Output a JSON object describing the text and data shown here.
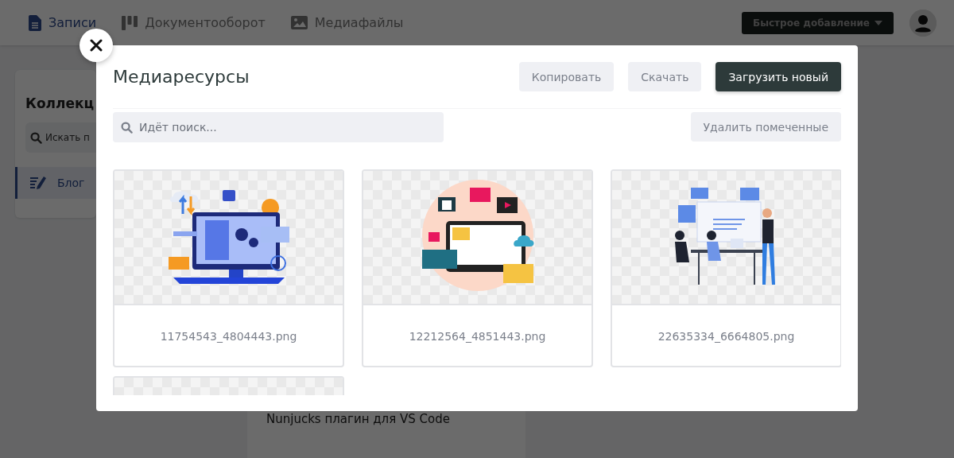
{
  "nav": {
    "items": [
      {
        "label": "Записи",
        "selected": true
      },
      {
        "label": "Документооборот",
        "selected": false
      },
      {
        "label": "Медиафайлы",
        "selected": false
      }
    ],
    "quick_add": "Быстрое добавление"
  },
  "sidebar": {
    "title": "Коллекц",
    "search": {
      "placeholder": "Искать п"
    },
    "items": [
      {
        "label": "Блог",
        "selected": true
      }
    ]
  },
  "content": {
    "entries": [
      "Nunjucks плагин для VS Code"
    ]
  },
  "modal": {
    "title": "Медиаресурсы",
    "actions": [
      {
        "label": "Копировать",
        "kind": "secondary"
      },
      {
        "label": "Скачать",
        "kind": "secondary"
      },
      {
        "label": "Загрузить новый",
        "kind": "primary"
      }
    ],
    "search": {
      "placeholder": "Идёт поиск..."
    },
    "delete_button": "Удалить помеченные",
    "files": [
      {
        "name": "11754543_4804443.png",
        "kind": "computer"
      },
      {
        "name": "12212564_4851443.png",
        "kind": "cms"
      },
      {
        "name": "22635334_6664805.png",
        "kind": "coding"
      },
      {
        "kind": "cut_off"
      }
    ]
  }
}
